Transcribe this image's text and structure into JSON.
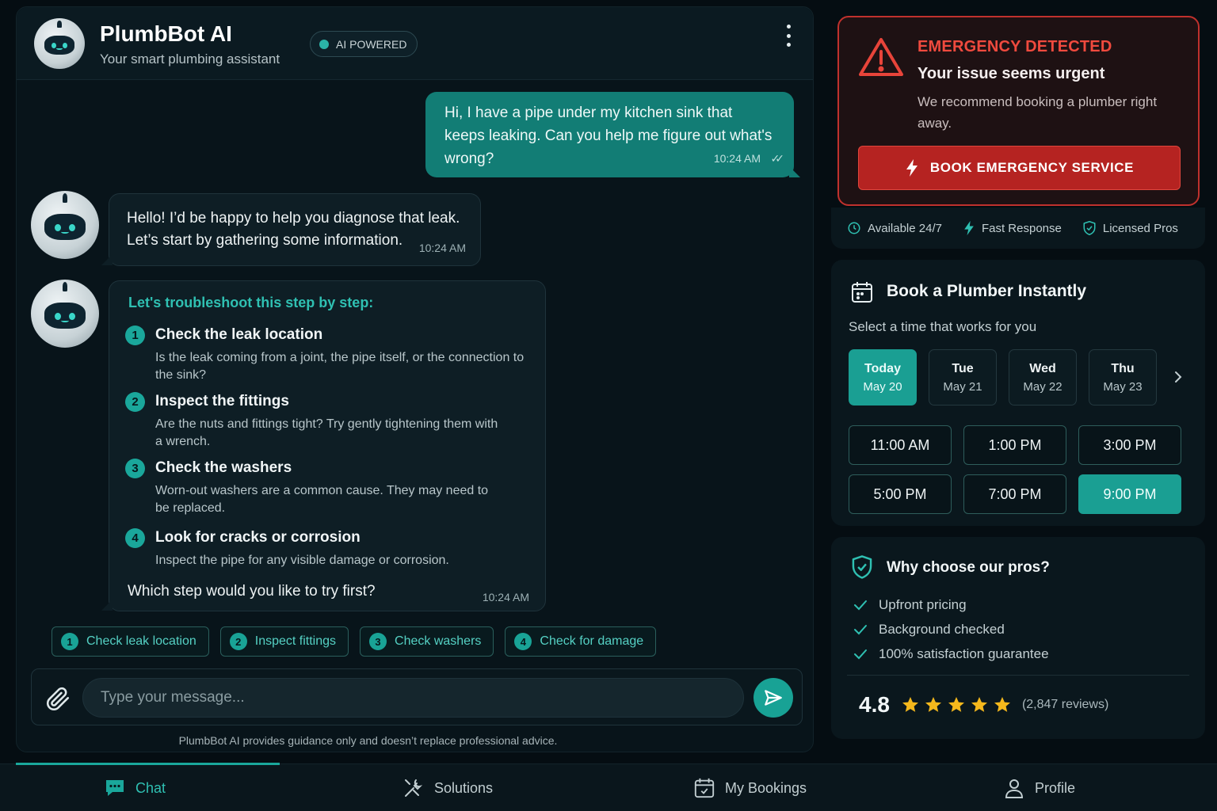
{
  "header": {
    "title": "PlumbBot AI",
    "subtitle": "Your smart plumbing assistant",
    "badge": "AI POWERED"
  },
  "messages": {
    "user": {
      "text": "Hi, I have a pipe under my kitchen sink that keeps leaking. Can you help me figure out what's wrong?",
      "time": "10:24 AM"
    },
    "bot1": {
      "text": "Hello! I’d be happy to help you diagnose that leak. Let’s start by gathering some information.",
      "time": "10:24 AM"
    },
    "bot2": {
      "title": "Let's troubleshoot this step by step:",
      "steps": [
        {
          "num": "1",
          "title": "Check the leak location",
          "desc": "Is the leak coming from a joint, the pipe itself, or the connection to the sink?"
        },
        {
          "num": "2",
          "title": "Inspect the fittings",
          "desc": "Are the nuts and fittings tight? Try gently tightening them with a wrench."
        },
        {
          "num": "3",
          "title": "Check the washers",
          "desc": "Worn-out washers are a common cause. They may need to be replaced."
        },
        {
          "num": "4",
          "title": "Look for cracks or corrosion",
          "desc": "Inspect the pipe for any visible damage or corrosion."
        }
      ],
      "question": "Which step would you like to try first?",
      "time": "10:24 AM"
    }
  },
  "quick_replies": [
    {
      "num": "1",
      "label": "Check leak location"
    },
    {
      "num": "2",
      "label": "Inspect fittings"
    },
    {
      "num": "3",
      "label": "Check washers"
    },
    {
      "num": "4",
      "label": "Check for damage"
    }
  ],
  "composer": {
    "placeholder": "Type your message...",
    "disclaimer": "PlumbBot AI provides guidance only and doesn’t replace professional advice."
  },
  "emergency": {
    "label": "EMERGENCY DETECTED",
    "title": "Your issue seems urgent",
    "desc": "We recommend booking a plumber right away.",
    "button": "BOOK EMERGENCY SERVICE"
  },
  "features": [
    "Available 24/7",
    "Fast Response",
    "Licensed Pros"
  ],
  "booking": {
    "title": "Book a Plumber Instantly",
    "subtitle": "Select a time that works for you",
    "days": [
      {
        "day": "Today",
        "date": "May 20"
      },
      {
        "day": "Tue",
        "date": "May 21"
      },
      {
        "day": "Wed",
        "date": "May 22"
      },
      {
        "day": "Thu",
        "date": "May 23"
      }
    ],
    "selected_day": "Today",
    "slots": [
      "11:00 AM",
      "1:00 PM",
      "3:00 PM",
      "5:00 PM",
      "7:00 PM",
      "9:00 PM"
    ],
    "selected_slot": "9:00 PM"
  },
  "why": {
    "title": "Why choose our pros?",
    "items": [
      "Upfront pricing",
      "Background checked",
      "100% satisfaction guarantee"
    ],
    "rating": "4.8",
    "stars": 5,
    "reviews": "(2,847 reviews)"
  },
  "nav": [
    "Chat",
    "Solutions",
    "My Bookings",
    "Profile"
  ],
  "colors": {
    "accent": "#1aa79b",
    "emergency": "#c0312d",
    "background": "#050d12"
  }
}
